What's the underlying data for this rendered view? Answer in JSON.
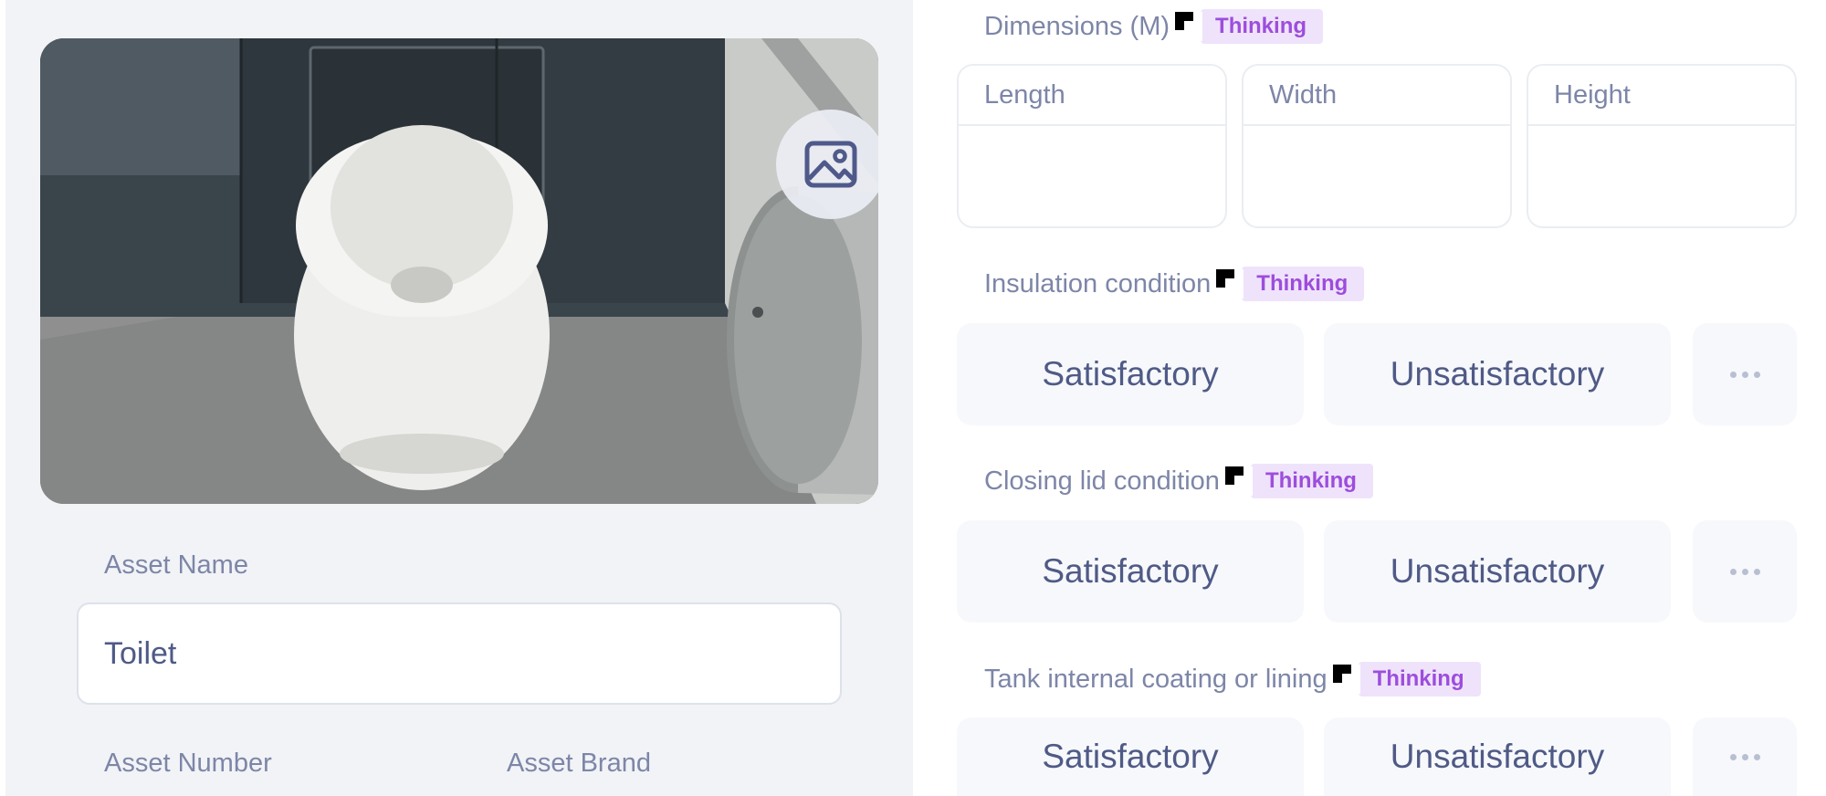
{
  "asset": {
    "name_label": "Asset Name",
    "name_value": "Toilet",
    "number_label": "Asset Number",
    "brand_label": "Asset Brand"
  },
  "icons": {
    "image_button": "image-icon",
    "cursor": "cursor-icon",
    "more": "more-horizontal-icon"
  },
  "colors": {
    "accent_badge_bg": "#efe3fb",
    "accent_badge_text": "#9d4ddc",
    "label_text": "#7d86a8",
    "option_text": "#4f5a86"
  },
  "badge_label": "Thinking",
  "dimensions": {
    "title": "Dimensions (M)",
    "fields": [
      {
        "label": "Length",
        "value": ""
      },
      {
        "label": "Width",
        "value": ""
      },
      {
        "label": "Height",
        "value": ""
      }
    ]
  },
  "conditions": [
    {
      "title": "Insulation condition",
      "options": [
        "Satisfactory",
        "Unsatisfactory"
      ]
    },
    {
      "title": "Closing lid condition",
      "options": [
        "Satisfactory",
        "Unsatisfactory"
      ]
    },
    {
      "title": "Tank internal coating or lining",
      "options": [
        "Satisfactory",
        "Unsatisfactory"
      ]
    }
  ]
}
